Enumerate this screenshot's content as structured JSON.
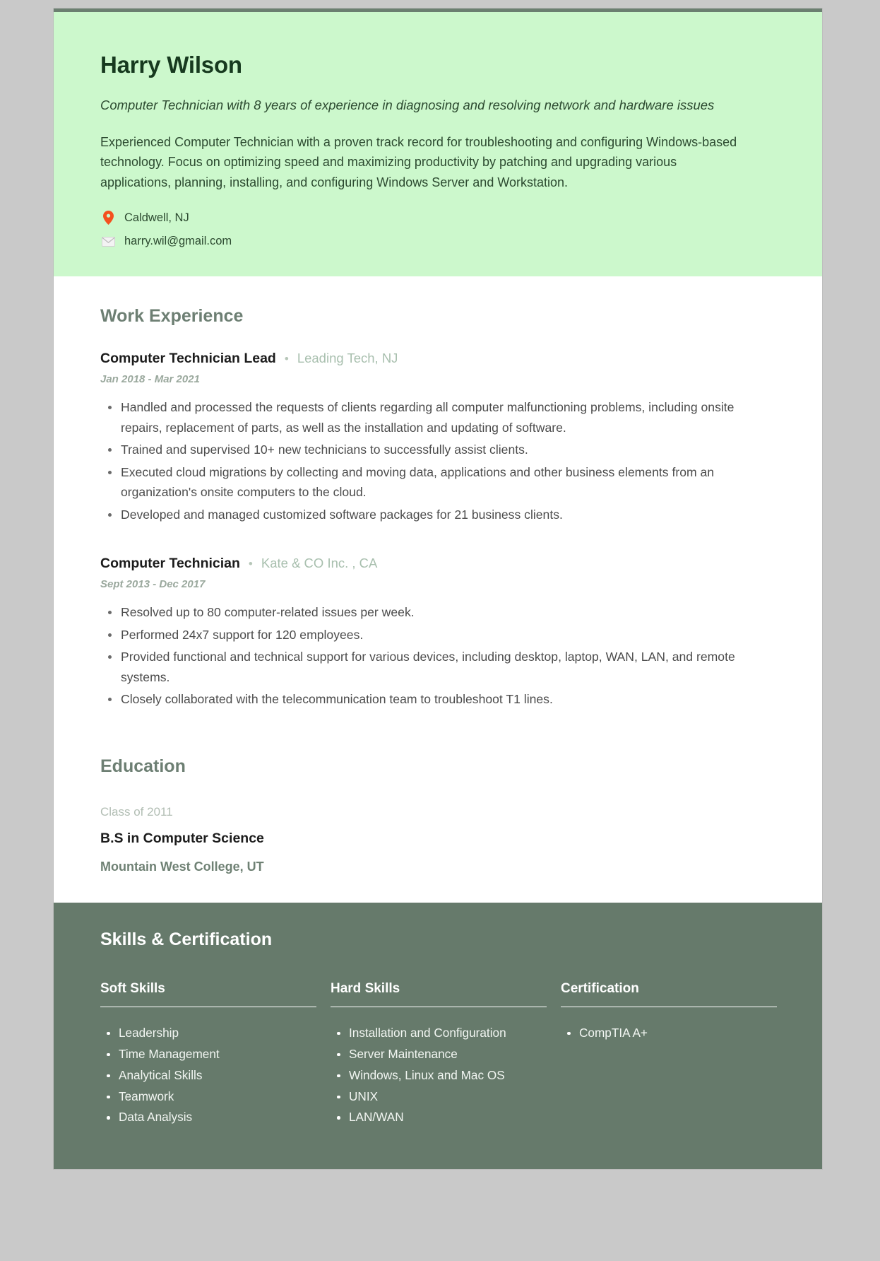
{
  "header": {
    "name": "Harry Wilson",
    "tagline": "Computer Technician with 8 years of experience in diagnosing and resolving network and hardware issues",
    "summary": "Experienced Computer Technician with a proven track record for troubleshooting and configuring Windows-based technology. Focus on optimizing speed and maximizing productivity by patching and upgrading various applications, planning, installing, and configuring Windows Server and Workstation.",
    "location": "Caldwell, NJ",
    "email": "harry.wil@gmail.com",
    "location_icon": "map-pin-icon",
    "email_icon": "envelope-icon",
    "background_color": "#ccf8cc",
    "text_color": "#2c4a30"
  },
  "work": {
    "section_title": "Work Experience",
    "jobs": [
      {
        "title": "Computer Technician Lead",
        "separator": "•",
        "company": "Leading Tech, NJ",
        "dates": "Jan 2018 - Mar 2021",
        "bullets": [
          "Handled and processed the requests of clients regarding all computer malfunctioning problems, including onsite repairs, replacement of parts, as well as the installation and updating of software.",
          "Trained and supervised 10+ new technicians to successfully assist clients.",
          "Executed cloud migrations by collecting and moving data, applications and other business elements from an organization's onsite computers to the cloud.",
          "Developed and managed customized software packages for 21 business clients."
        ]
      },
      {
        "title": "Computer Technician",
        "separator": "•",
        "company": "Kate & CO Inc. , CA",
        "dates": "Sept 2013 - Dec 2017",
        "bullets": [
          "Resolved up to 80 computer-related issues per week.",
          "Performed 24x7 support for 120 employees.",
          "Provided functional and technical support for various devices, including desktop, laptop, WAN, LAN, and remote systems.",
          "Closely collaborated with the telecommunication team to troubleshoot T1 lines."
        ]
      }
    ]
  },
  "education": {
    "section_title": "Education",
    "class_of": "Class of 2011",
    "degree": "B.S in Computer Science",
    "school": "Mountain West College, UT"
  },
  "skills": {
    "section_title": "Skills & Certification",
    "background_color": "#667a6b",
    "columns": [
      {
        "heading": "Soft Skills",
        "items": [
          "Leadership",
          "Time Management",
          "Analytical Skills",
          "Teamwork",
          "Data Analysis"
        ]
      },
      {
        "heading": "Hard Skills",
        "items": [
          "Installation and Configuration",
          "Server Maintenance",
          "Windows, Linux and Mac OS",
          "UNIX",
          "LAN/WAN"
        ]
      },
      {
        "heading": "Certification",
        "items": [
          "CompTIA A+"
        ]
      }
    ]
  }
}
